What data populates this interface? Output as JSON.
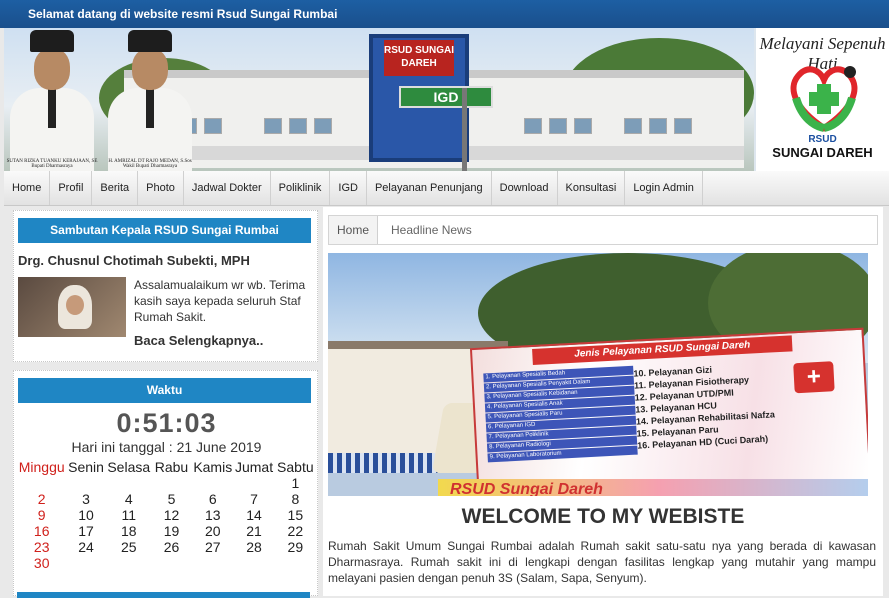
{
  "topbar": {
    "welcome": "Selamat datang di website resmi Rsud Sungai Rumbai"
  },
  "banner": {
    "tower_sign": "RSUD SUNGAI DAREH",
    "igd_sign": "IGD",
    "person1_caption": "SUTAN RIZKA TUANKU KERAJAAN, SE  Bupati Dharmasraya",
    "person2_caption": "H. AMRIZAL DT RAJO MEDAN, S.Sos  Wakil Bupati Dharmasraya",
    "logo_motto": "Melayani Sepenuh Hati",
    "logo_rsud": "RSUD",
    "logo_name": "SUNGAI DAREH",
    "logo_colors": {
      "red": "#e0262b",
      "green": "#3bb34a"
    }
  },
  "nav": {
    "items": [
      "Home",
      "Profil",
      "Berita",
      "Photo",
      "Jadwal Dokter",
      "Poliklinik",
      "IGD",
      "Pelayanan Penunjang",
      "Download",
      "Konsultasi",
      "Login Admin"
    ]
  },
  "sambutan": {
    "heading": "Sambutan Kepala RSUD Sungai Rumbai",
    "name": "Drg. Chusnul Chotimah Subekti, MPH",
    "text": "Assalamualaikum wr wb. Terima kasih saya kepada seluruh Staf Rumah Sakit.",
    "read_more": "Baca Selengkapnya.."
  },
  "waktu": {
    "heading": "Waktu",
    "clock": "0:51:03",
    "date_line": "Hari ini tanggal : 21 June 2019"
  },
  "calendar": {
    "days": [
      "Minggu",
      "Senin",
      "Selasa",
      "Rabu",
      "Kamis",
      "Jumat",
      "Sabtu"
    ],
    "weeks": [
      [
        "",
        "",
        "",
        "",
        "",
        "",
        "1"
      ],
      [
        "2",
        "3",
        "4",
        "5",
        "6",
        "7",
        "8"
      ],
      [
        "9",
        "10",
        "11",
        "12",
        "13",
        "14",
        "15"
      ],
      [
        "16",
        "17",
        "18",
        "19",
        "20",
        "21",
        "22"
      ],
      [
        "23",
        "24",
        "25",
        "26",
        "27",
        "28",
        "29"
      ],
      [
        "30",
        "",
        "",
        "",
        "",
        "",
        ""
      ]
    ],
    "sunday_color": "#d0201b"
  },
  "breadcrumb": {
    "home": "Home",
    "current": "Headline News"
  },
  "headline_photo": {
    "banner_title": "Jenis Pelayanan RSUD Sungai Dareh",
    "services_left": [
      "1. Pelayanan Spesialis Bedah",
      "2. Pelayanan Spesialis Penyakit Dalam",
      "3. Pelayanan Spesialis Kebidanan",
      "4. Pelayanan Spesialis Anak",
      "5. Pelayanan Spesialis Paru",
      "6. Pelayanan IGD",
      "7. Pelayanan Poliklinik",
      "8. Pelayanan Radiologi",
      "9. Pelayanan Laboratorium"
    ],
    "services_right": [
      "10. Pelayanan Gizi",
      "11. Pelayanan Fisiotherapy",
      "12. Pelayanan UTD/PMI",
      "13. Pelayanan HCU",
      "14. Pelayanan Rehabilitasi Nafza",
      "15. Pelayanan Paru",
      "16. Pelayanan HD (Cuci Darah)"
    ],
    "bottom_text": "RSUD Sungai Dareh"
  },
  "welcome": {
    "title": "WELCOME TO MY WEBISTE",
    "body": "Rumah Sakit Umum Sungai Rumbai adalah Rumah sakit satu-satu nya yang berada di kawasan Dharmasraya. Rumah sakit ini di lengkapi dengan fasilitas lengkap yang mutahir yang mampu melayani pasien dengan penuh 3S (Salam, Sapa, Senyum)."
  },
  "colors": {
    "topbar": "#1d5fa3",
    "panel_head": "#1f86c4",
    "clock": "#555555"
  }
}
